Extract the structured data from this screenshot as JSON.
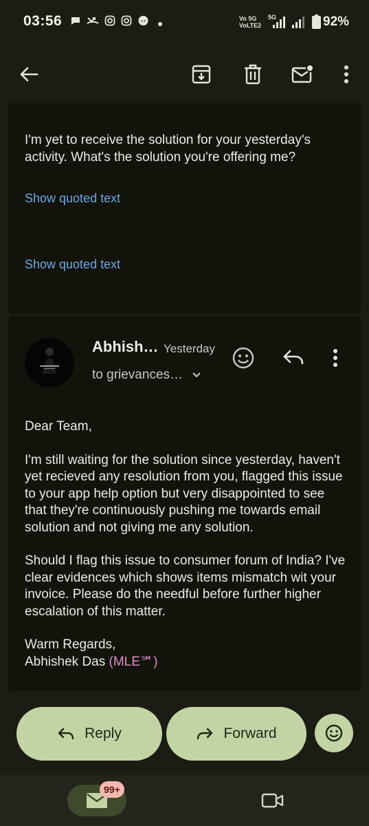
{
  "status_bar": {
    "time": "03:56",
    "network_top": "Vo 5G",
    "network_bottom": "VoLTE2",
    "band": "5G",
    "battery": "92%"
  },
  "toolbar": {
    "icons": [
      "back-arrow-icon",
      "archive-icon",
      "delete-icon",
      "mark-unread-icon",
      "more-vert-icon"
    ]
  },
  "previous_message": {
    "body": "I'm yet to receive the solution for your yesterday's activity. What's the solution you're offering me?",
    "show_quoted_1": "Show quoted text",
    "show_quoted_2": "Show quoted text"
  },
  "message": {
    "sender": "Abhish…",
    "time": "Yesterday",
    "recipients": "to grievances…",
    "greeting": "Dear Team,",
    "paragraph1": "I'm still waiting for the solution since yesterday, haven't yet recieved any resolution from you, flagged this issue to your app help option but very disappointed to see that they're continuously pushing me towards email solution and not giving me any solution.",
    "paragraph2": "Should I flag this issue to consumer forum of India? I've clear evidences which shows items mismatch wit your invoice. Please do the needful before further higher escalation of this matter.",
    "sign_off": "Warm Regards,",
    "signature_name": "Abhishek Das",
    "signature_tag": "(MLE℠)",
    "signature_tag_color": "#d98bc8"
  },
  "actions": {
    "reply": "Reply",
    "forward": "Forward"
  },
  "bottom_nav": {
    "mail_badge": "99+"
  },
  "colors": {
    "background": "#1b1c13",
    "card": "#12140c",
    "accent_button": "#c2d4a4",
    "link": "#6ea6e3"
  }
}
